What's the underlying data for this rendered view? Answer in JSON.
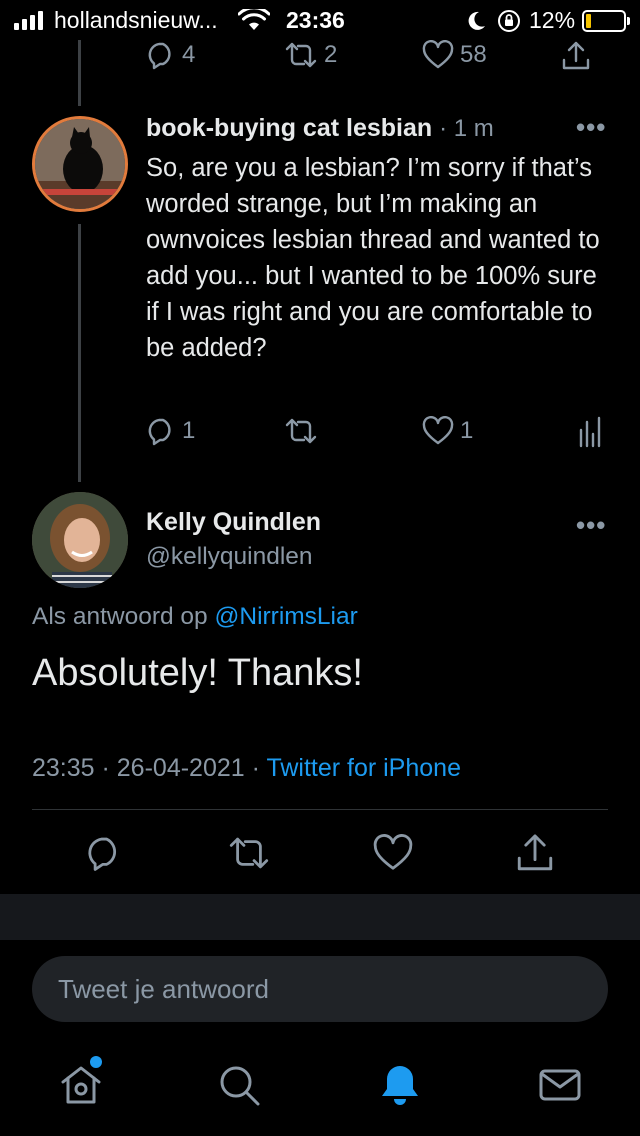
{
  "status_bar": {
    "carrier": "hollandsnieuw...",
    "time": "23:36",
    "battery": "12%"
  },
  "top_tweet_actions": {
    "reply_count": "4",
    "retweet_count": "2",
    "like_count": "58"
  },
  "reply_tweet": {
    "author_name": "book-buying cat lesbian",
    "time_ago": "· 1 m",
    "text": "So, are you a lesbian? I’m sorry if that’s worded strange, but I’m making an ownvoices lesbian thread and wanted to add you... but I wanted to be 100% sure if I was right and you are comfortable to be added?",
    "reply_count": "1",
    "like_count": "1"
  },
  "main_tweet": {
    "author_name": "Kelly Quindlen",
    "handle": "@kellyquindlen",
    "reply_prefix": "Als antwoord op ",
    "reply_mention": "@NirrimsLiar",
    "text": "Absolutely! Thanks!",
    "datetime": "23:35 · 26-04-2021 · ",
    "client": "Twitter for iPhone"
  },
  "composer": {
    "placeholder": "Tweet je antwoord"
  },
  "colors": {
    "accent": "#1d9bf0",
    "muted": "#8b98a5",
    "background": "#000000"
  },
  "icons": [
    "reply-icon",
    "retweet-icon",
    "like-icon",
    "share-icon",
    "analytics-icon",
    "more-icon",
    "home-icon",
    "search-icon",
    "notifications-icon",
    "messages-icon"
  ]
}
